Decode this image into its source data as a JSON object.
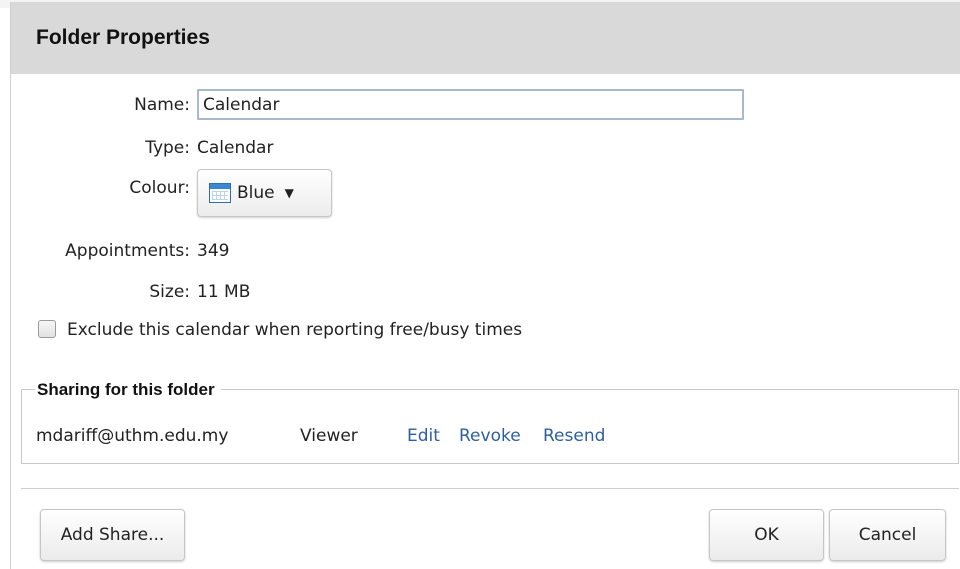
{
  "dialog": {
    "title": "Folder Properties"
  },
  "fields": {
    "name_label": "Name:",
    "name_value": "Calendar",
    "type_label": "Type:",
    "type_value": "Calendar",
    "colour_label": "Colour:",
    "colour_value": "Blue",
    "appointments_label": "Appointments:",
    "appointments_value": "349",
    "size_label": "Size:",
    "size_value": "11 MB"
  },
  "icons": {
    "colour": "calendar-icon",
    "dropdown": "chevron-down-icon"
  },
  "exclude_checkbox": {
    "label": "Exclude this calendar when reporting free/busy times",
    "checked": false
  },
  "sharing": {
    "heading": "Sharing for this folder",
    "shares": [
      {
        "email": "mdariff@uthm.edu.my",
        "role": "Viewer",
        "actions": [
          "Edit",
          "Revoke",
          "Resend"
        ]
      }
    ]
  },
  "buttons": {
    "add_share": "Add Share...",
    "ok": "OK",
    "cancel": "Cancel"
  },
  "colors": {
    "titlebar_bg": "#d9d9d9",
    "link": "#2c5f9e",
    "calendar_blue": "#3b86d1"
  }
}
